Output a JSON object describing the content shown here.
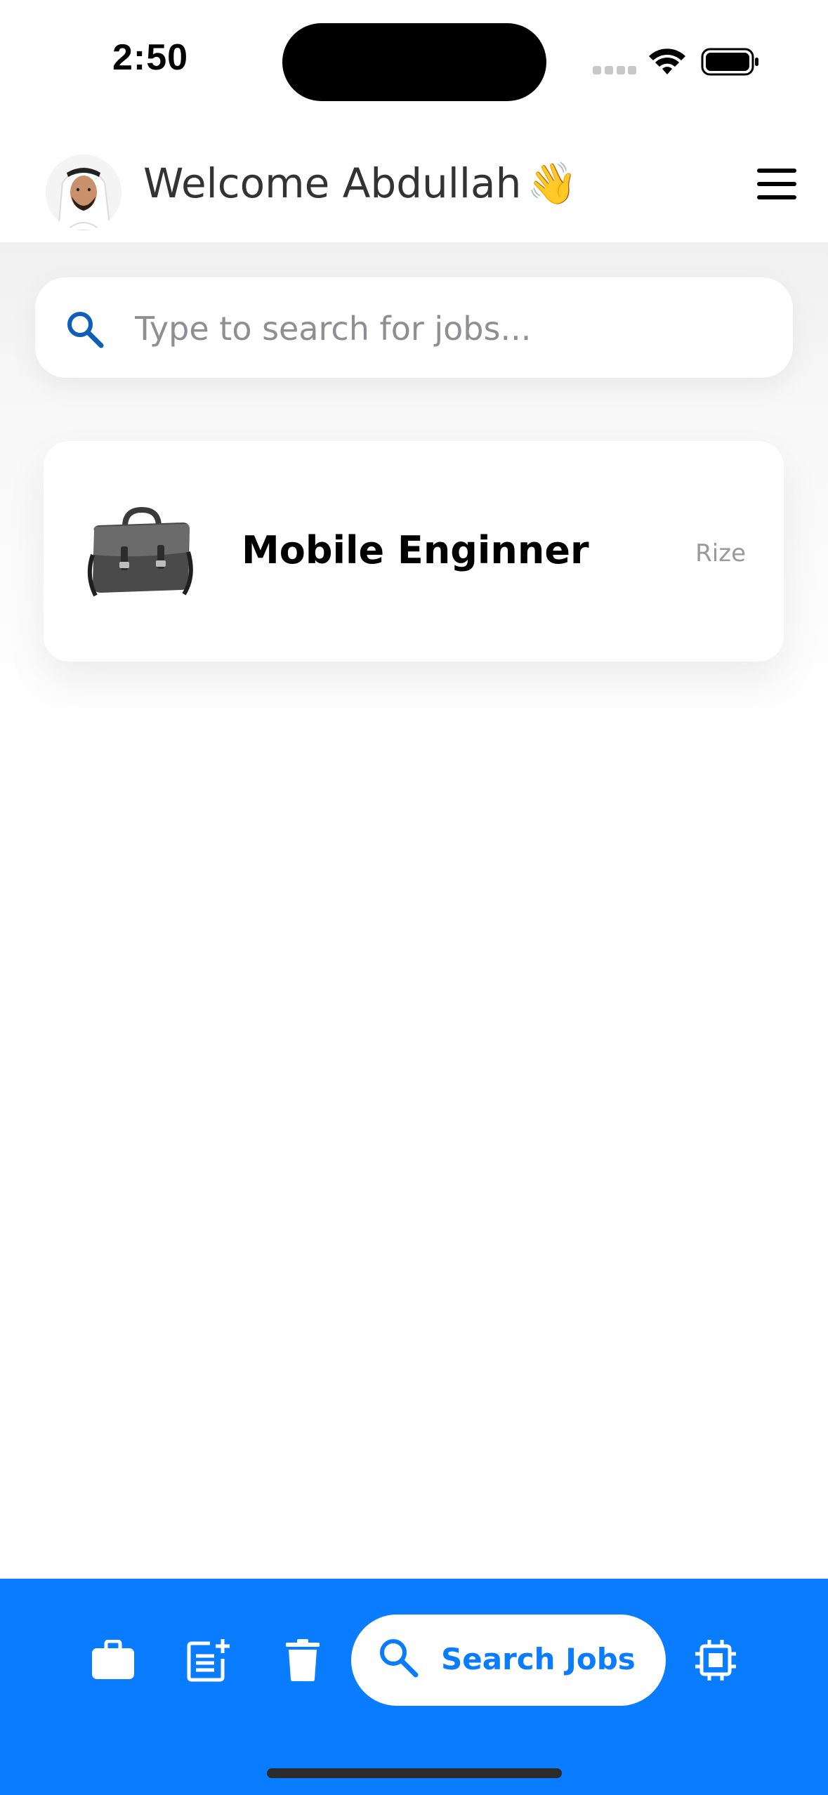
{
  "status_bar": {
    "time": "2:50"
  },
  "header": {
    "welcome_text": "Welcome Abdullah",
    "wave_emoji": "👋",
    "avatar_icon": "user-avatar",
    "menu_icon": "hamburger-menu-icon"
  },
  "search": {
    "placeholder": "Type to search for jobs...",
    "value": "",
    "icon": "search-icon",
    "icon_color": "#0f5fb8"
  },
  "jobs": [
    {
      "title": "Mobile Enginner",
      "company": "Rize",
      "image_icon": "briefcase-bag-image"
    }
  ],
  "tab_bar": {
    "background": "#0a7cff",
    "items": [
      {
        "icon": "briefcase-icon"
      },
      {
        "icon": "post-add-icon"
      },
      {
        "icon": "trash-icon"
      },
      {
        "icon": "search-icon",
        "label": "Search Jobs",
        "active": true
      },
      {
        "icon": "chip-icon"
      }
    ]
  }
}
